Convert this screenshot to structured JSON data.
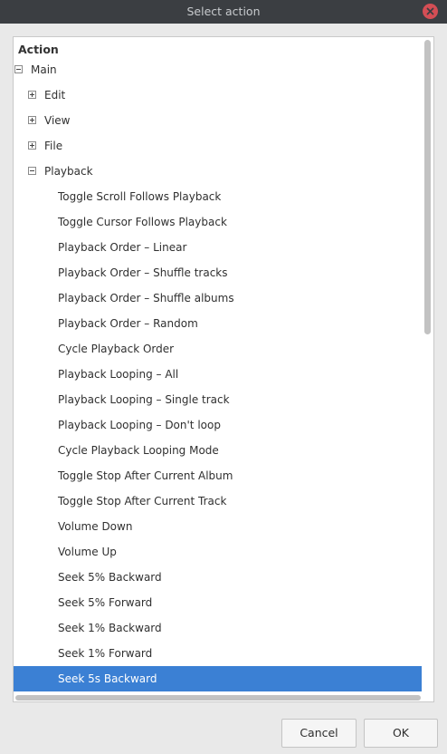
{
  "window": {
    "title": "Select action"
  },
  "tree": {
    "header": "Action",
    "items": [
      {
        "label": "Main",
        "expander": "collapse"
      },
      {
        "label": "Edit",
        "expander": "expand"
      },
      {
        "label": "View",
        "expander": "expand"
      },
      {
        "label": "File",
        "expander": "expand"
      },
      {
        "label": "Playback",
        "expander": "collapse"
      },
      {
        "label": "Toggle Scroll Follows Playback"
      },
      {
        "label": "Toggle Cursor Follows Playback"
      },
      {
        "label": "Playback Order – Linear"
      },
      {
        "label": "Playback Order – Shuffle tracks"
      },
      {
        "label": "Playback Order – Shuffle albums"
      },
      {
        "label": "Playback Order – Random"
      },
      {
        "label": "Cycle Playback Order"
      },
      {
        "label": "Playback Looping – All"
      },
      {
        "label": "Playback Looping – Single track"
      },
      {
        "label": "Playback Looping – Don't loop"
      },
      {
        "label": "Cycle Playback Looping Mode"
      },
      {
        "label": "Toggle Stop After Current Album"
      },
      {
        "label": "Toggle Stop After Current Track"
      },
      {
        "label": "Volume Down"
      },
      {
        "label": "Volume Up"
      },
      {
        "label": "Seek 5% Backward"
      },
      {
        "label": "Seek 5% Forward"
      },
      {
        "label": "Seek 1% Backward"
      },
      {
        "label": "Seek 1% Forward"
      },
      {
        "label": "Seek 5s Backward",
        "selected": true
      }
    ]
  },
  "buttons": {
    "cancel": "Cancel",
    "ok": "OK"
  },
  "colors": {
    "titlebar": "#3b3e42",
    "selection": "#3b80d4",
    "close": "#d44e55"
  }
}
